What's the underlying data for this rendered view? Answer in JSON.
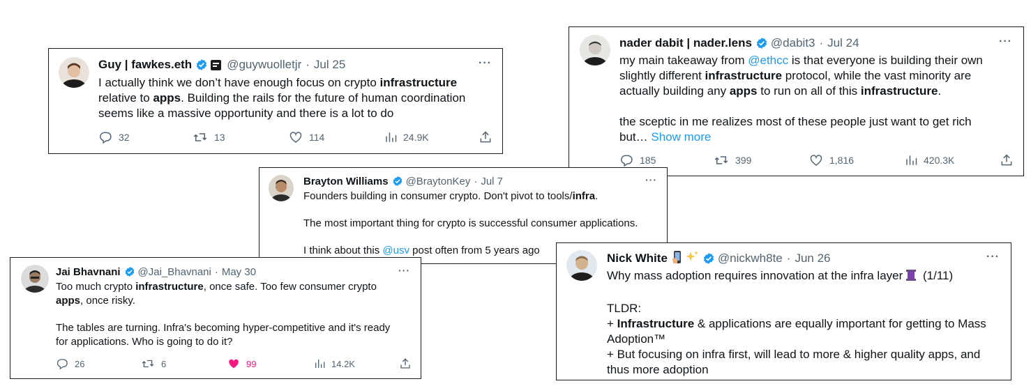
{
  "tweets": {
    "guy": {
      "name": "Guy | fawkes.eth",
      "handle": "@guywuolletjr",
      "sep": "·",
      "date": "Jul 25",
      "more": "···",
      "t1": "I actually think we don’t have enough focus on crypto ",
      "b1": "infrastructure",
      "t2": "relative to ",
      "b2": "apps",
      "t3": ". Building the rails for the future of human coordination",
      "t4": "seems like a massive opportunity and there is a lot to do",
      "replies": "32",
      "retweets": "13",
      "likes": "114",
      "views": "24.9K"
    },
    "nader": {
      "name": "nader dabit | nader.lens",
      "handle": "@dabit3",
      "sep": "·",
      "date": "Jul 24",
      "more": "···",
      "t1": "my main takeaway from ",
      "link": "@ethcc",
      "t2": " is that everyone is building their own",
      "t3": "slightly different ",
      "b1": "infrastructure",
      "t4": " protocol, while the vast minority are",
      "t5": "actually building any ",
      "b2": "apps",
      "t6": " to run on all of this ",
      "b3": "infrastructure",
      "t7": ".",
      "t8": "the sceptic in me realizes most of these people just want to get rich",
      "t9": "but… ",
      "show_more": "Show more",
      "replies": "185",
      "retweets": "399",
      "likes": "1,816",
      "views": "420.3K"
    },
    "brayton": {
      "name": "Brayton Williams",
      "handle": "@BraytonKey",
      "sep": "·",
      "date": "Jul 7",
      "more": "···",
      "t1": "Founders building in consumer crypto. Don't pivot to tools/",
      "b1": "infra",
      "t2": ".",
      "t3": "The most important thing for crypto is successful consumer applications.",
      "t4": "I think about this ",
      "link": "@usv",
      "t5": " post often from 5 years ago"
    },
    "jai": {
      "name": "Jai Bhavnani",
      "handle": "@Jai_Bhavnani",
      "sep": "·",
      "date": "May 30",
      "more": "···",
      "t1": "Too much crypto ",
      "b1": "infrastructure",
      "t2": ", once safe. Too few consumer crypto",
      "b2": "apps",
      "t3": ", once risky.",
      "t4": "The tables are turning. Infra's becoming hyper-competitive and it's ready",
      "t5": "for applications. Who is going to do it?",
      "replies": "26",
      "retweets": "6",
      "likes": "99",
      "views": "14.2K"
    },
    "nick": {
      "name": "Nick White",
      "handle": "@nickwh8te",
      "sep": "·",
      "date": "Jun 26",
      "more": "···",
      "t1": "Why mass adoption requires innovation at the infra layer",
      "t1b": " (1/11)",
      "t2": "TLDR:",
      "t3": "+ ",
      "b1": "Infrastructure",
      "t4": " & applications are equally important for getting to Mass",
      "t5": "Adoption™",
      "t6": "+ But focusing on infra first, will lead to more & higher quality apps, and",
      "t7": "thus more adoption"
    }
  },
  "colors": {
    "verified": "#1d9bf0",
    "link": "#1d9bf0",
    "like": "#f91880",
    "muted": "#536471"
  },
  "icons": [
    "reply-icon",
    "retweet-icon",
    "like-icon",
    "views-icon",
    "share-icon",
    "verified-badge-icon",
    "more-icon"
  ]
}
